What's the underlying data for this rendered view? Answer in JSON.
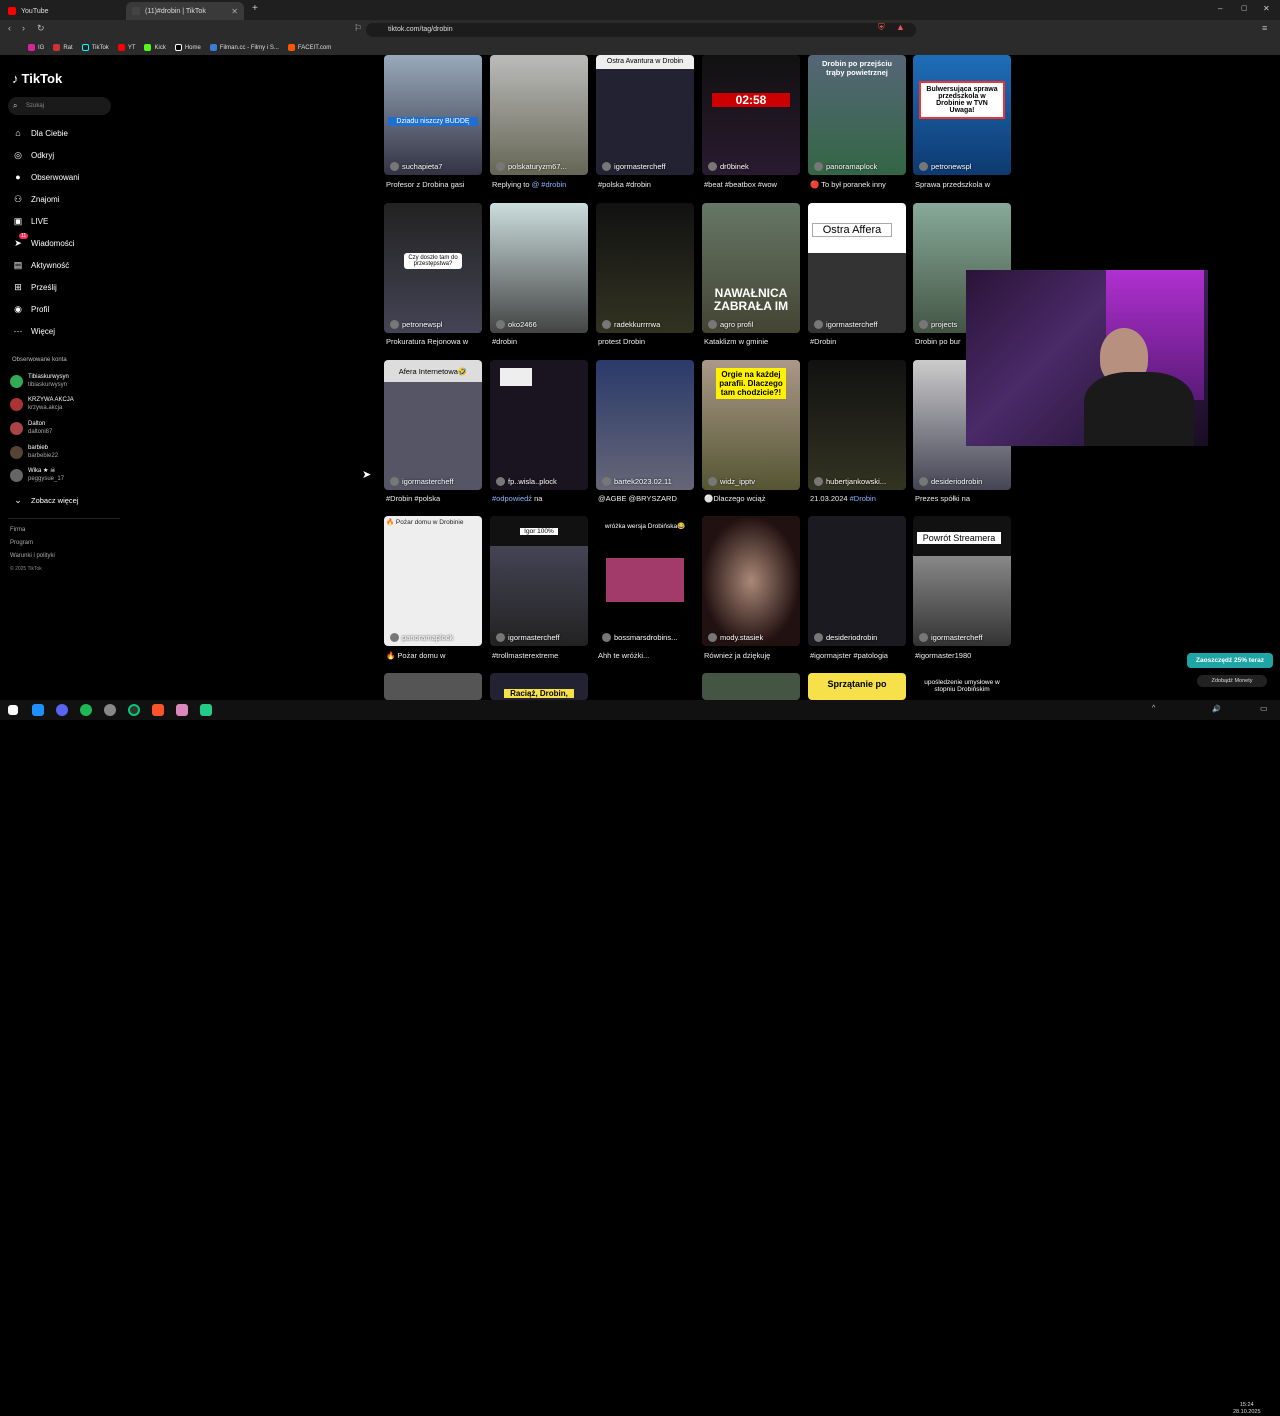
{
  "browser": {
    "tabs": [
      {
        "label": "YouTube"
      },
      {
        "label": "(11)#drobin | TikTok"
      }
    ],
    "url": "tiktok.com/tag/drobin",
    "bookmarks": [
      "IG",
      "Rat",
      "TikTok",
      "YT",
      "Kick",
      "Home",
      "Filman.cc - Filmy i S...",
      "FACEIT.com"
    ]
  },
  "sidebar": {
    "logo": "TikTok",
    "search_placeholder": "Szukaj",
    "nav": [
      "Dla Ciebie",
      "Odkryj",
      "Obserwowani",
      "Znajomi",
      "LIVE",
      "Wiadomości",
      "Aktywność",
      "Prześlij",
      "Profil",
      "Więcej"
    ],
    "messages_badge": "11",
    "followed_header": "Obserwowane konta",
    "accounts": [
      {
        "name": "Tibiaskurwysyn",
        "handle": "tibiaskurwysyn"
      },
      {
        "name": "KRZYWA AKCJA",
        "handle": "krzywa.akcja"
      },
      {
        "name": "Dalton",
        "handle": "daltoni87"
      },
      {
        "name": "barbieb",
        "handle": "barbebie22"
      },
      {
        "name": "Wika ★ ☠",
        "handle": "peggysue_17"
      }
    ],
    "see_more": "Zobacz więcej",
    "footer": [
      "Firma",
      "Program",
      "Warunki i polityki",
      "© 2025 TikTok"
    ]
  },
  "grid": {
    "row1": [
      {
        "user": "suchapieta7",
        "caption": "Profesor z Drobina gasi",
        "overlay": "Dziadu niszczy BUDDĘ"
      },
      {
        "user": "polskaturyzm67...",
        "caption_pre": "Replying to ",
        "caption_tag": "@ #drobin",
        "overlay": ""
      },
      {
        "user": "igormastercheff",
        "caption_tag": "#polska #drobin",
        "overlay": "Ostra Avantura w Drobin"
      },
      {
        "user": "dr0binek",
        "caption_tag": "#beat #beatbox #wow",
        "overlay": "02:58"
      },
      {
        "user": "panoramaplock",
        "caption": "🔴 To był poranek inny",
        "overlay": "Drobin po przejściu trąby powietrznej"
      },
      {
        "user": "petronewspl",
        "caption": "Sprawa przedszkola w",
        "overlay": "Bulwersująca sprawa przedszkola w Drobinie w TVN Uwaga!"
      }
    ],
    "row2": [
      {
        "user": "petronewspl",
        "caption": "Prokuratura Rejonowa w",
        "overlay": "Czy doszło tam do przestępstwa?"
      },
      {
        "user": "oko2466",
        "caption_tag": "#drobin"
      },
      {
        "user": "radekkurrrrwa",
        "caption": "protest Drobin"
      },
      {
        "user": "agro profil",
        "caption": "Kataklizm w gminie",
        "overlay": "NAWAŁNICA ZABRAŁA IM"
      },
      {
        "user": "igormastercheff",
        "caption_tag": "#Drobin",
        "overlay": "Ostra Affera"
      },
      {
        "user": "projects",
        "caption": "Drobin po bur"
      }
    ],
    "row3": [
      {
        "user": "igormastercheff",
        "caption_tag": "#Drobin #polska",
        "overlay": "Afera Internetowa🤣"
      },
      {
        "user": "fp..wisla..plock",
        "caption_tag": "#odpowiedź",
        "caption_post": " na"
      },
      {
        "user": "bartek2023.02.11",
        "caption_tag": "@AGBE @BRYSZARD"
      },
      {
        "user": "widz_ipptv",
        "caption": "⚪Dlaczego wciąż",
        "overlay": "Orgie na każdej parafii. Dlaczego tam chodzicie?!"
      },
      {
        "user": "hubertjankowski...",
        "caption_pre": "21.03.2024 ",
        "caption_tag": "#Drobin"
      },
      {
        "user": "desideriodrobin",
        "caption": "Prezes spółki na"
      }
    ],
    "row4": [
      {
        "user": "panoramaplock",
        "caption": "🔥 Pożar domu w",
        "overlay": "🔥 Pożar domu w Drobinie"
      },
      {
        "user": "igormastercheff",
        "caption_tag": "#trollmasterextreme",
        "overlay": "Igor 100%"
      },
      {
        "user": "bossmarsdrobins...",
        "caption": "Ahh te wróżki...",
        "overlay": "wróżka wersja Drobińska😂"
      },
      {
        "user": "mody.stasiek",
        "caption": "Również ja dziękuję"
      },
      {
        "user": "desideriodrobin",
        "caption_tag": "#igormajster #patologia"
      },
      {
        "user": "igormastercheff",
        "caption_tag": "#igormaster1980",
        "overlay": "Powrót Streamera"
      }
    ],
    "row5_overlays": [
      "Raciąż, Drobin,",
      "Sprzątanie po",
      "upośledzenie umysłowe w stopniu Drobińskim"
    ]
  },
  "promo": {
    "label": "Zaoszczędź 25% teraz",
    "coins": "Zdobądź Monety"
  },
  "clock": {
    "time": "15:24",
    "date": "28.10.2025"
  }
}
